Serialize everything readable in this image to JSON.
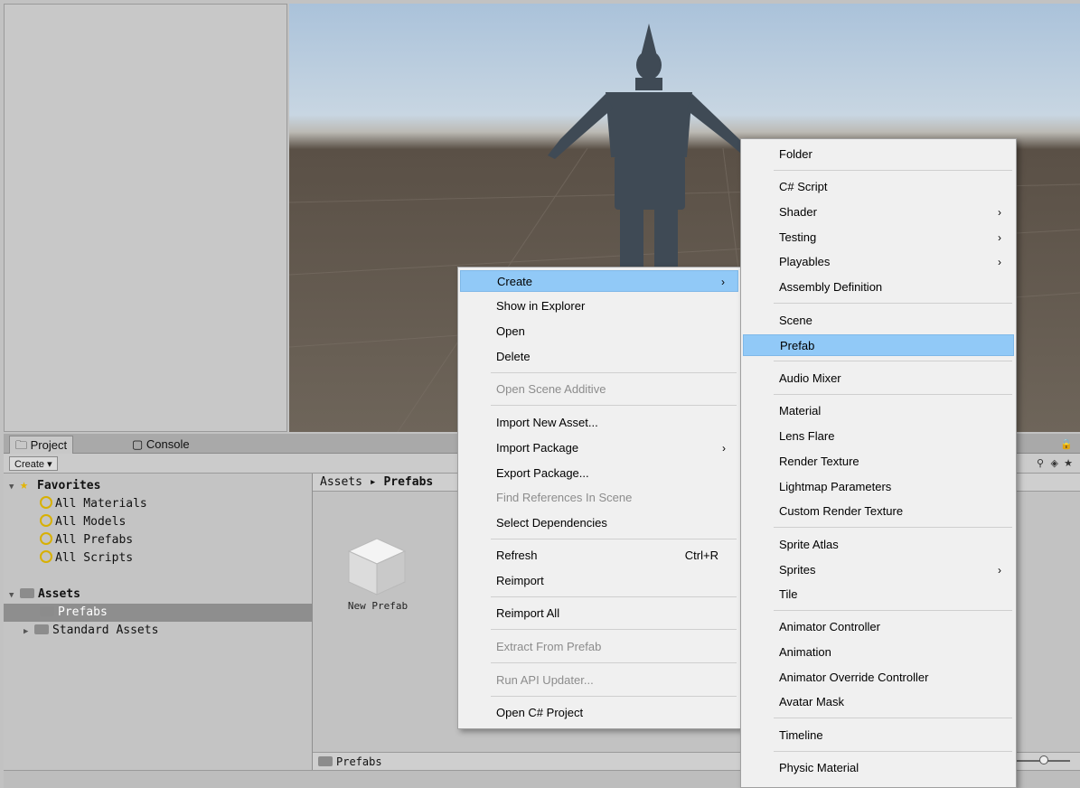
{
  "project_panel": {
    "tabs": [
      {
        "label": "Project",
        "icon": "folder-icon"
      },
      {
        "label": "Console",
        "icon": "console-icon"
      }
    ],
    "create_label": "Create ▾",
    "favorites": {
      "label": "Favorites",
      "items": [
        "All Materials",
        "All Models",
        "All Prefabs",
        "All Scripts"
      ]
    },
    "assets": {
      "label": "Assets",
      "items": [
        "Prefabs",
        "Standard Assets"
      ],
      "selected": "Prefabs"
    },
    "breadcrumb": {
      "root": "Assets",
      "sep": "▸",
      "current": "Prefabs"
    },
    "asset_items": [
      {
        "label": "New Prefab"
      }
    ],
    "status_path": "Prefabs"
  },
  "context_menu": {
    "items": [
      {
        "label": "Create",
        "arrow": "›",
        "highlighted": true
      },
      {
        "label": "Show in Explorer"
      },
      {
        "label": "Open"
      },
      {
        "label": "Delete"
      },
      {
        "label": "Open Scene Additive",
        "disabled": true
      },
      {
        "label": "Import New Asset..."
      },
      {
        "label": "Import Package",
        "arrow": "›"
      },
      {
        "label": "Export Package..."
      },
      {
        "label": "Find References In Scene",
        "disabled": true
      },
      {
        "label": "Select Dependencies"
      },
      {
        "label": "Refresh",
        "shortcut": "Ctrl+R"
      },
      {
        "label": "Reimport"
      },
      {
        "label": "Reimport All"
      },
      {
        "label": "Extract From Prefab",
        "disabled": true
      },
      {
        "label": "Run API Updater...",
        "disabled": true
      },
      {
        "label": "Open C# Project"
      }
    ]
  },
  "create_submenu": {
    "items": [
      {
        "label": "Folder"
      },
      {
        "label": "C# Script"
      },
      {
        "label": "Shader",
        "arrow": "›"
      },
      {
        "label": "Testing",
        "arrow": "›"
      },
      {
        "label": "Playables",
        "arrow": "›"
      },
      {
        "label": "Assembly Definition"
      },
      {
        "label": "Scene"
      },
      {
        "label": "Prefab",
        "highlighted": true
      },
      {
        "label": "Audio Mixer"
      },
      {
        "label": "Material"
      },
      {
        "label": "Lens Flare"
      },
      {
        "label": "Render Texture"
      },
      {
        "label": "Lightmap Parameters"
      },
      {
        "label": "Custom Render Texture"
      },
      {
        "label": "Sprite Atlas"
      },
      {
        "label": "Sprites",
        "arrow": "›"
      },
      {
        "label": "Tile"
      },
      {
        "label": "Animator Controller"
      },
      {
        "label": "Animation"
      },
      {
        "label": "Animator Override Controller"
      },
      {
        "label": "Avatar Mask"
      },
      {
        "label": "Timeline"
      },
      {
        "label": "Physic Material"
      }
    ]
  },
  "colors": {
    "highlight": "#91c9f7",
    "menu_bg": "#f0f0f0",
    "selected_row": "#8e8e8e"
  }
}
